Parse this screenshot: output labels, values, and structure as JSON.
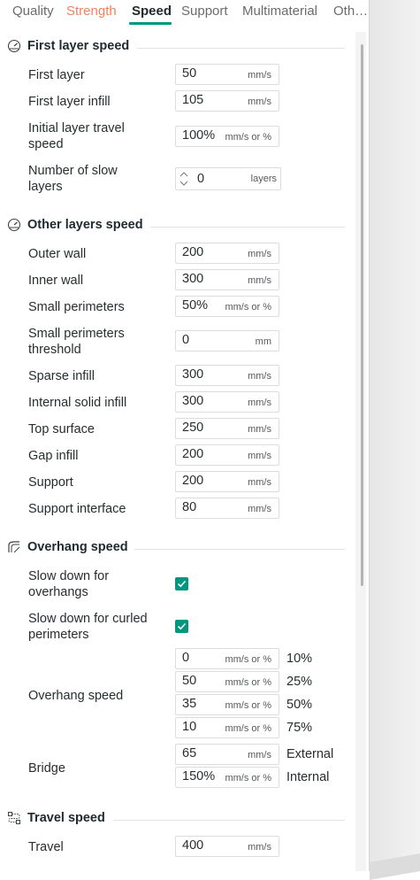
{
  "tabs": [
    {
      "label": "Quality",
      "state": "normal"
    },
    {
      "label": "Strength",
      "state": "warning"
    },
    {
      "label": "Speed",
      "state": "active"
    },
    {
      "label": "Support",
      "state": "normal"
    },
    {
      "label": "Multimaterial",
      "state": "normal"
    },
    {
      "label": "Oth…",
      "state": "normal"
    }
  ],
  "colors": {
    "accent": "#00967f",
    "warning_tab": "#f0825a"
  },
  "first_layer": {
    "title": "First layer speed",
    "icon": "speedometer-icon",
    "first_layer": {
      "label": "First layer",
      "value": "50",
      "unit": "mm/s"
    },
    "first_layer_infill": {
      "label": "First layer infill",
      "value": "105",
      "unit": "mm/s"
    },
    "initial_travel": {
      "label_line1": "Initial layer travel",
      "label_line2": "speed",
      "value": "100%",
      "unit": "mm/s or %"
    },
    "slow_layers": {
      "label_line1": "Number of slow",
      "label_line2": "layers",
      "value": "0",
      "unit": "layers"
    }
  },
  "other_layers": {
    "title": "Other layers speed",
    "icon": "speedometer-icon",
    "outer_wall": {
      "label": "Outer wall",
      "value": "200",
      "unit": "mm/s"
    },
    "inner_wall": {
      "label": "Inner wall",
      "value": "300",
      "unit": "mm/s"
    },
    "small_perimeters": {
      "label": "Small perimeters",
      "value": "50%",
      "unit": "mm/s or %"
    },
    "small_perimeters_threshold": {
      "label_line1": "Small perimeters",
      "label_line2": "threshold",
      "value": "0",
      "unit": "mm"
    },
    "sparse_infill": {
      "label": "Sparse infill",
      "value": "300",
      "unit": "mm/s"
    },
    "internal_solid_infill": {
      "label": "Internal solid infill",
      "value": "300",
      "unit": "mm/s"
    },
    "top_surface": {
      "label": "Top surface",
      "value": "250",
      "unit": "mm/s"
    },
    "gap_infill": {
      "label": "Gap infill",
      "value": "200",
      "unit": "mm/s"
    },
    "support": {
      "label": "Support",
      "value": "200",
      "unit": "mm/s"
    },
    "support_interface": {
      "label": "Support interface",
      "value": "80",
      "unit": "mm/s"
    }
  },
  "overhang": {
    "title": "Overhang speed",
    "icon": "overhang-icon",
    "slow_down_overhangs": {
      "label_line1": "Slow down for",
      "label_line2": "overhangs",
      "checked": true
    },
    "slow_down_curled": {
      "label_line1": "Slow down for curled",
      "label_line2": "perimeters",
      "checked": true
    },
    "overhang_speed": {
      "label": "Overhang speed",
      "rows": [
        {
          "value": "0",
          "unit": "mm/s or %",
          "suffix": "10%"
        },
        {
          "value": "50",
          "unit": "mm/s or %",
          "suffix": "25%"
        },
        {
          "value": "35",
          "unit": "mm/s or %",
          "suffix": "50%"
        },
        {
          "value": "10",
          "unit": "mm/s or %",
          "suffix": "75%"
        }
      ]
    },
    "bridge": {
      "label": "Bridge",
      "external": {
        "value": "65",
        "unit": "mm/s",
        "suffix": "External"
      },
      "internal": {
        "value": "150%",
        "unit": "mm/s or %",
        "suffix": "Internal"
      }
    }
  },
  "travel": {
    "title": "Travel speed",
    "icon": "travel-icon",
    "travel": {
      "label": "Travel",
      "value": "400",
      "unit": "mm/s"
    }
  }
}
